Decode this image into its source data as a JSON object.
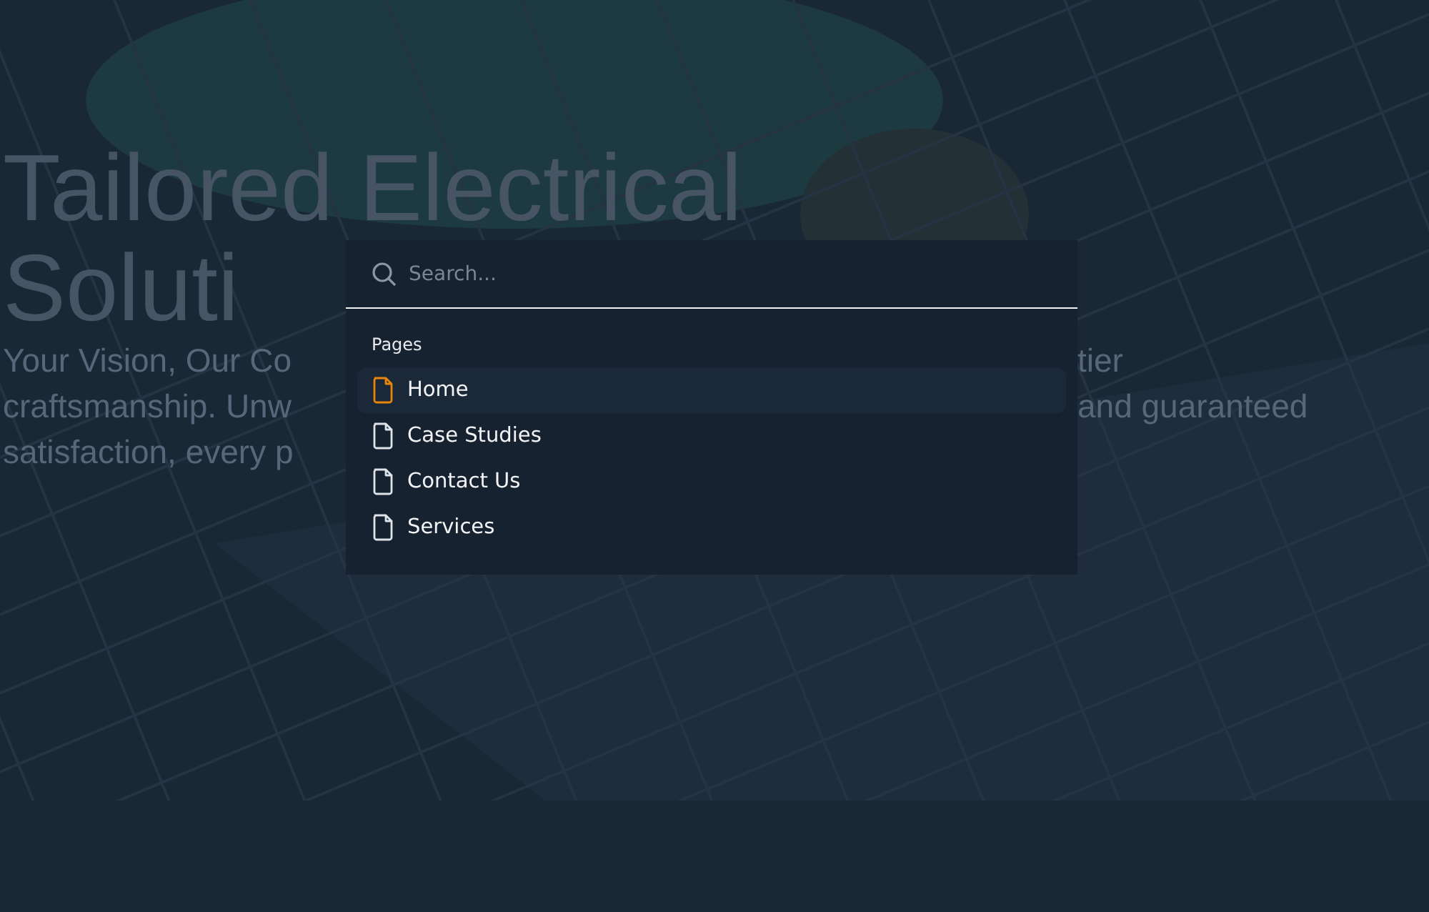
{
  "hero": {
    "title_lines": [
      "Tailored Electrical",
      "Soluti"
    ],
    "subtitle_lines": [
      {
        "left": "Your Vision, Our Co",
        "right": "tier"
      },
      {
        "left": "craftsmanship. Unw",
        "right": "and guaranteed"
      },
      {
        "left": "satisfaction, every p"
      }
    ]
  },
  "search": {
    "placeholder": "Search..."
  },
  "results": {
    "heading": "Pages",
    "items": [
      {
        "label": "Home",
        "selected": true
      },
      {
        "label": "Case Studies",
        "selected": false
      },
      {
        "label": "Contact Us",
        "selected": false
      },
      {
        "label": "Services",
        "selected": false
      }
    ]
  }
}
